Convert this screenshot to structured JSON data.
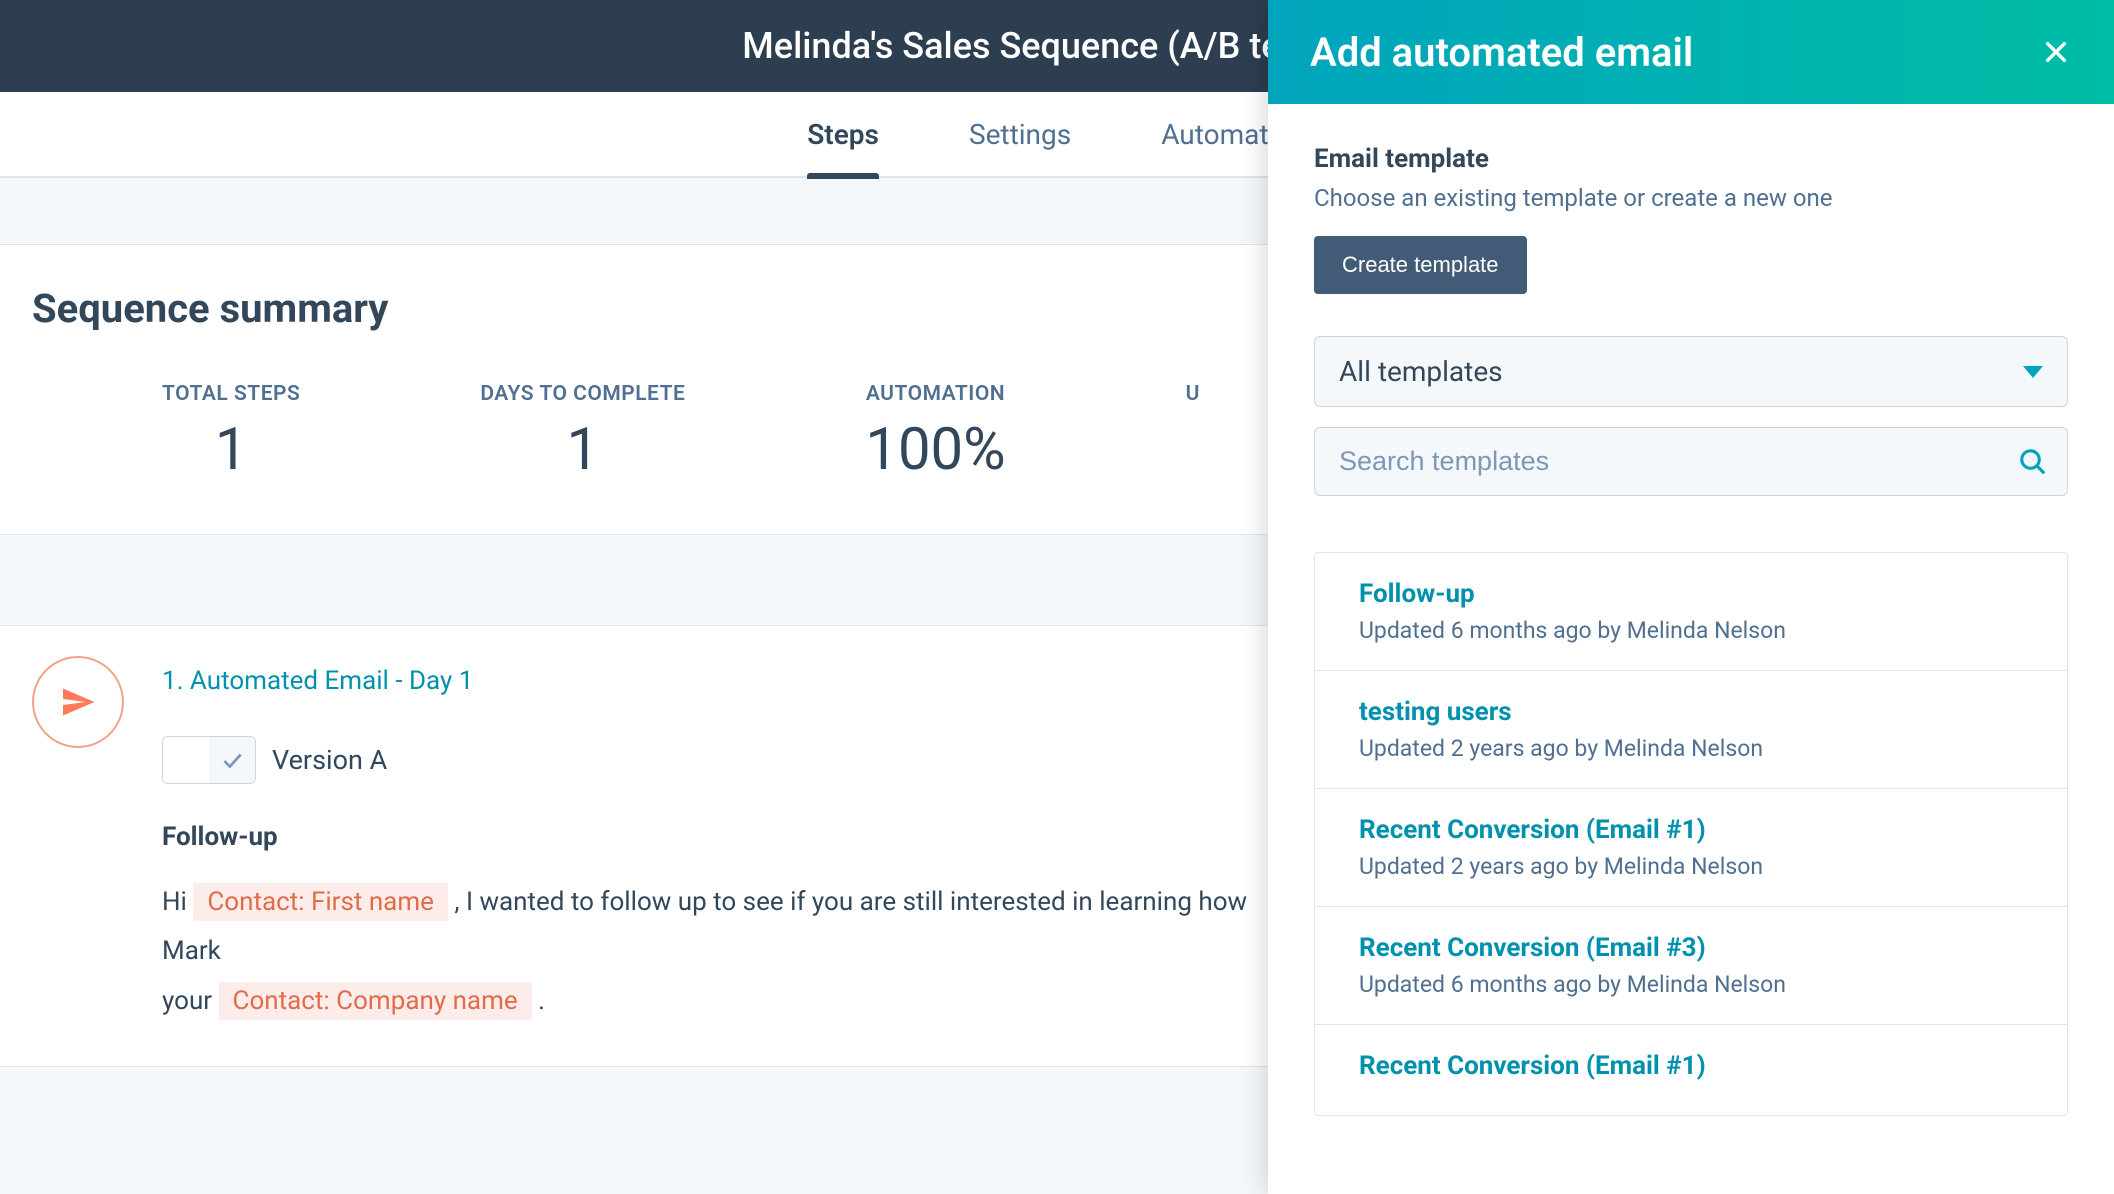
{
  "header": {
    "title": "Melinda's Sales Sequence (A/B test)"
  },
  "tabs": [
    {
      "label": "Steps",
      "active": true
    },
    {
      "label": "Settings",
      "active": false
    },
    {
      "label": "Automation",
      "active": false
    }
  ],
  "summary": {
    "title": "Sequence summary",
    "stats": [
      {
        "label": "TOTAL STEPS",
        "value": "1"
      },
      {
        "label": "DAYS TO COMPLETE",
        "value": "1"
      },
      {
        "label": "AUTOMATION",
        "value": "100%"
      },
      {
        "label": "U",
        "value": ""
      }
    ]
  },
  "step": {
    "title": "1. Automated Email - Day 1",
    "version_label": "Version A",
    "template_name": "Follow-up",
    "body_pre": "Hi ",
    "token1": "Contact: First name",
    "body_mid": " , I wanted to follow up to see if you are still interested in learning how Mark",
    "body_line2_pre": "your ",
    "token2": "Contact: Company name",
    "body_line2_post": " ."
  },
  "panel": {
    "title": "Add automated email",
    "section_label": "Email template",
    "section_desc": "Choose an existing template or create a new one",
    "create_btn": "Create template",
    "dropdown_value": "All templates",
    "search_placeholder": "Search templates",
    "templates": [
      {
        "title": "Follow-up",
        "meta": "Updated 6 months ago by Melinda Nelson"
      },
      {
        "title": "testing users",
        "meta": "Updated 2 years ago by Melinda Nelson"
      },
      {
        "title": "Recent Conversion (Email #1)",
        "meta": "Updated 2 years ago by Melinda Nelson"
      },
      {
        "title": "Recent Conversion (Email #3)",
        "meta": "Updated 6 months ago by Melinda Nelson"
      },
      {
        "title": "Recent Conversion (Email #1)",
        "meta": ""
      }
    ]
  }
}
